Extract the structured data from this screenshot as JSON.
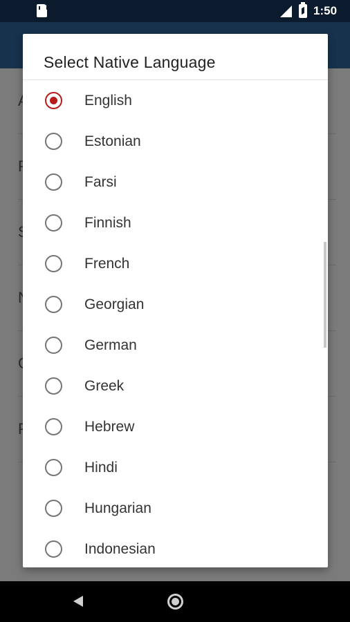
{
  "status_bar": {
    "time": "1:50",
    "icons": [
      "sd-card-icon",
      "signal-icon",
      "battery-icon"
    ]
  },
  "dialog": {
    "title": "Select Native Language",
    "selected": "English",
    "accent_color": "#b71c1c",
    "options": [
      {
        "label": "English",
        "checked": true
      },
      {
        "label": "Estonian",
        "checked": false
      },
      {
        "label": "Farsi",
        "checked": false
      },
      {
        "label": "Finnish",
        "checked": false
      },
      {
        "label": "French",
        "checked": false
      },
      {
        "label": "Georgian",
        "checked": false
      },
      {
        "label": "German",
        "checked": false
      },
      {
        "label": "Greek",
        "checked": false
      },
      {
        "label": "Hebrew",
        "checked": false
      },
      {
        "label": "Hindi",
        "checked": false
      },
      {
        "label": "Hungarian",
        "checked": false
      },
      {
        "label": "Indonesian",
        "checked": false
      }
    ]
  },
  "background": {
    "app_bar_color": "#17324d",
    "rows": [
      {
        "letter": "A"
      },
      {
        "letter": "P"
      },
      {
        "letter": "S"
      },
      {
        "letter": "N"
      },
      {
        "letter": "C"
      },
      {
        "letter": "P"
      }
    ]
  },
  "nav_bar": {
    "icons": [
      "back-icon",
      "home-icon"
    ]
  }
}
